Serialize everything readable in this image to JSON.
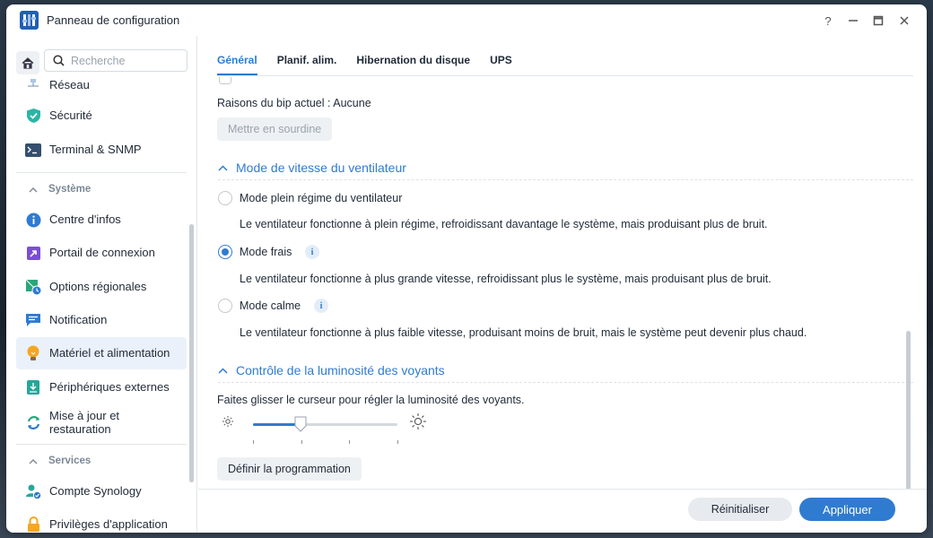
{
  "window": {
    "title": "Panneau de configuration",
    "controls": [
      "help-icon",
      "minimize-icon",
      "maximize-icon",
      "close-icon"
    ]
  },
  "sidebar": {
    "search_placeholder": "Recherche",
    "items": [
      {
        "label": "Réseau",
        "icon": "network-icon"
      },
      {
        "label": "Sécurité",
        "icon": "shield-icon"
      },
      {
        "label": "Terminal & SNMP",
        "icon": "terminal-icon"
      },
      {
        "label": "Centre d'infos",
        "icon": "info-icon"
      },
      {
        "label": "Portail de connexion",
        "icon": "login-portal-icon"
      },
      {
        "label": "Options régionales",
        "icon": "regional-icon"
      },
      {
        "label": "Notification",
        "icon": "notification-icon"
      },
      {
        "label": "Matériel et alimentation",
        "icon": "bulb-icon",
        "active": true
      },
      {
        "label": "Périphériques externes",
        "icon": "external-device-icon"
      },
      {
        "label": "Mise à jour et restauration",
        "icon": "update-icon"
      },
      {
        "label": "Compte Synology",
        "icon": "synology-account-icon"
      },
      {
        "label": "Privilèges d'application",
        "icon": "lock-icon"
      }
    ],
    "sections": {
      "systeme": "Système",
      "services": "Services"
    }
  },
  "tabs": [
    {
      "label": "Général",
      "active": true
    },
    {
      "label": "Planif. alim."
    },
    {
      "label": "Hibernation du disque"
    },
    {
      "label": "UPS"
    }
  ],
  "beep": {
    "reason_text": "Raisons du bip actuel : Aucune",
    "mute_button": "Mettre en sourdine"
  },
  "fan": {
    "section_title": "Mode de vitesse du ventilateur",
    "options": [
      {
        "label": "Mode plein régime du ventilateur",
        "desc": "Le ventilateur fonctionne à plein régime, refroidissant davantage le système, mais produisant plus de bruit.",
        "selected": false,
        "info": false
      },
      {
        "label": "Mode frais",
        "desc": "Le ventilateur fonctionne à plus grande vitesse, refroidissant plus le système, mais produisant plus de bruit.",
        "selected": true,
        "info": true
      },
      {
        "label": "Mode calme",
        "desc": "Le ventilateur fonctionne à plus faible vitesse, produisant moins de bruit, mais le système peut devenir plus chaud.",
        "selected": false,
        "info": true
      }
    ]
  },
  "led": {
    "section_title": "Contrôle de la luminosité des voyants",
    "instructions": "Faites glisser le curseur pour régler la luminosité des voyants.",
    "slider_level": 0.33,
    "slider_steps": 4,
    "schedule_button": "Définir la programmation"
  },
  "footer": {
    "reset_button": "Réinitialiser",
    "apply_button": "Appliquer"
  },
  "colors": {
    "accent": "#2f7bd0",
    "active_bg": "#eaf1fa"
  }
}
